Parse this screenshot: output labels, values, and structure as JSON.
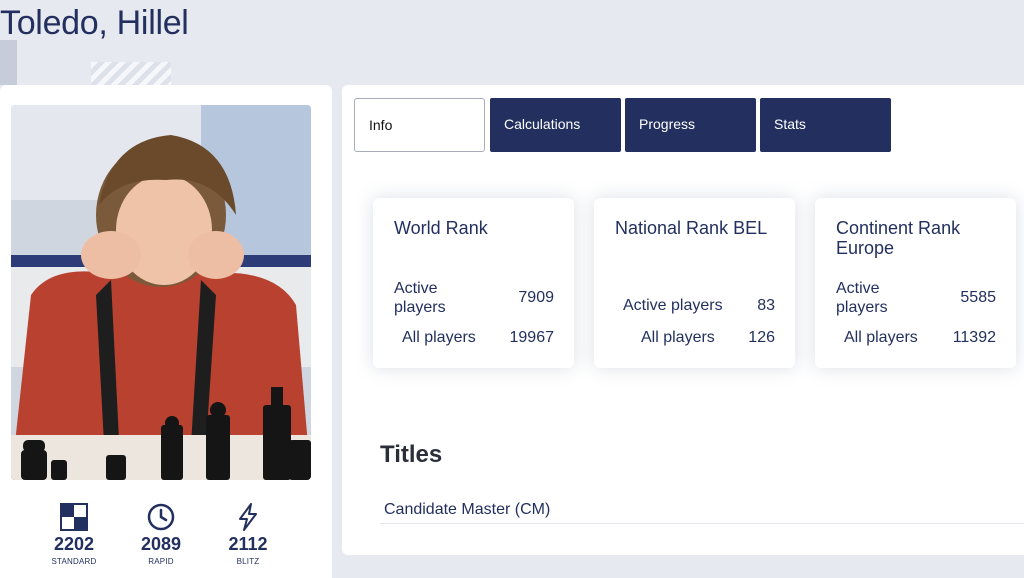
{
  "player": {
    "name": "Toledo, Hillel"
  },
  "ratings": [
    {
      "icon": "standard-board-icon",
      "value": "2202",
      "label": "STANDARD"
    },
    {
      "icon": "clock-icon",
      "value": "2089",
      "label": "RAPID"
    },
    {
      "icon": "lightning-icon",
      "value": "2112",
      "label": "BLITZ"
    }
  ],
  "tabs": [
    {
      "label": "Info",
      "active": true
    },
    {
      "label": "Calculations",
      "active": false
    },
    {
      "label": "Progress",
      "active": false
    },
    {
      "label": "Stats",
      "active": false
    }
  ],
  "ranks": [
    {
      "title": "World Rank",
      "active_label": "Active players",
      "active_value": "7909",
      "all_label": "All players",
      "all_value": "19967"
    },
    {
      "title": "National Rank BEL",
      "active_label": "Active players",
      "active_value": "83",
      "all_label": "All players",
      "all_value": "126"
    },
    {
      "title": "Continent Rank Europe",
      "active_label": "Active players",
      "active_value": "5585",
      "all_label": "All players",
      "all_value": "11392"
    }
  ],
  "titles": {
    "heading": "Titles",
    "items": [
      "Candidate Master (CM)"
    ]
  },
  "colors": {
    "brand_navy": "#23305f",
    "page_background": "#e6e9ef",
    "panel_background": "#ffffff"
  }
}
